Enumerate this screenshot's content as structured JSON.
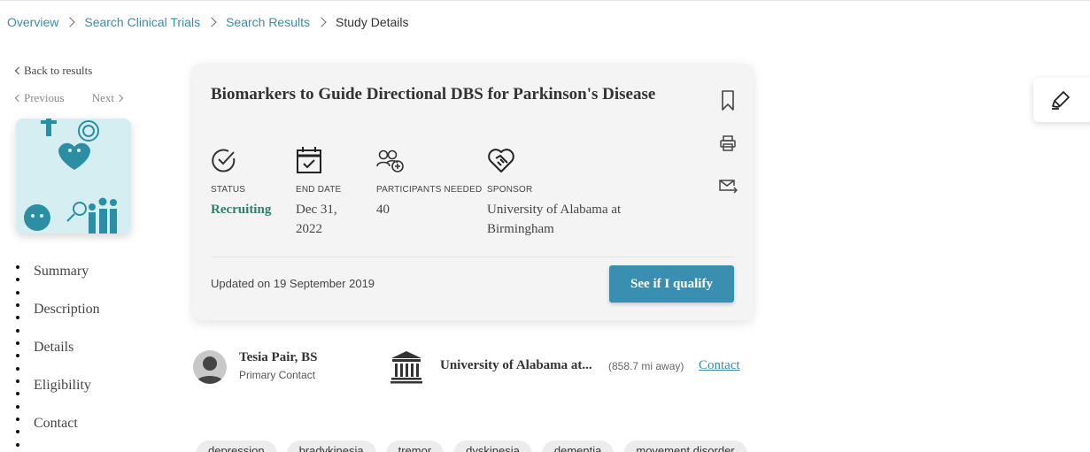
{
  "breadcrumb": {
    "items": [
      "Overview",
      "Search Clinical Trials",
      "Search Results"
    ],
    "current": "Study Details"
  },
  "nav": {
    "back": "Back to results",
    "previous": "Previous",
    "next": "Next"
  },
  "thumbnail": {
    "icon": "clinical-illustration"
  },
  "side_menu": [
    "Summary",
    "Description",
    "Details",
    "Eligibility",
    "Contact"
  ],
  "study": {
    "title": "Biomarkers to Guide Directional DBS for Parkinson's Disease",
    "status_label": "STATUS",
    "status_value": "Recruiting",
    "end_date_label": "END DATE",
    "end_date_value": "Dec 31, 2022",
    "participants_label": "PARTICIPANTS NEEDED",
    "participants_value": "40",
    "sponsor_label": "SPONSOR",
    "sponsor_value": "University of Alabama at Birmingham",
    "updated": "Updated on 19 September 2019",
    "qualify_button": "See if I qualify"
  },
  "contact": {
    "name": "Tesia Pair, BS",
    "role": "Primary Contact",
    "institution": "University of Alabama at...",
    "distance": "(858.7 mi away)",
    "link": "Contact"
  },
  "tags": [
    "depression",
    "bradykinesia",
    "tremor",
    "dyskinesia",
    "dementia",
    "movement disorder"
  ],
  "colors": {
    "accent": "#3a8fb0",
    "link": "#3a8da6",
    "status": "#2d7f6c",
    "thumbnail_bg": "#d4eef2",
    "thumbnail_figure": "#2c8ea3"
  }
}
